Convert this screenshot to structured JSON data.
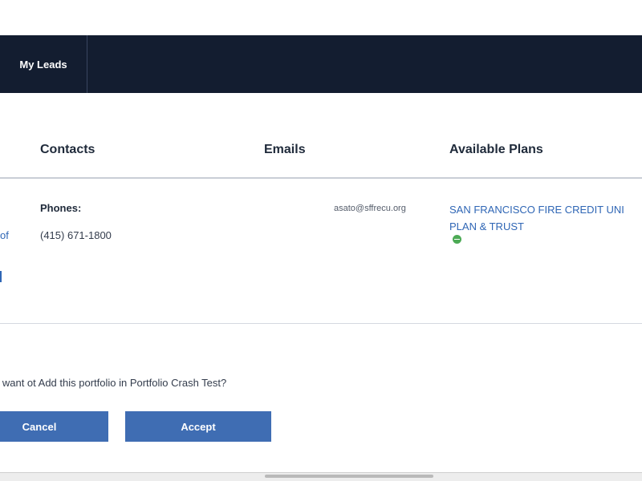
{
  "nav": {
    "items": [
      {
        "label": "My Leads"
      }
    ]
  },
  "table": {
    "headers": {
      "contacts": "Contacts",
      "emails": "Emails",
      "plans": "Available Plans"
    },
    "row": {
      "phones_label": "Phones:",
      "phone": "(415) 671-1800",
      "email": "asato@sffrecu.org",
      "plan_line1": "SAN FRANCISCO FIRE CREDIT UNI",
      "plan_line2": "PLAN & TRUST",
      "left_fragment": "of"
    }
  },
  "dialog": {
    "prompt": "o want ot Add this portfolio in Portfolio Crash Test?",
    "cancel_label": "Cancel",
    "accept_label": "Accept"
  },
  "colors": {
    "nav_bg": "#131d30",
    "button_bg": "#3f6db3",
    "link": "#2f66b5",
    "status_icon": "#4caa55"
  }
}
